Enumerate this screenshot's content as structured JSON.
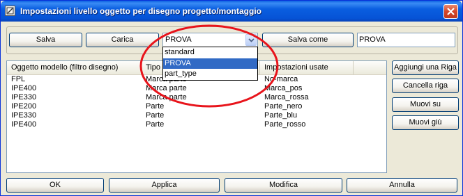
{
  "window": {
    "title": "Impostazioni livello oggetto per disegno progetto/montaggio"
  },
  "toolbar": {
    "save_label": "Salva",
    "load_label": "Carica",
    "save_as_label": "Salva come",
    "preset_combo_value": "PROVA",
    "preset_name_value": "PROVA",
    "preset_options": [
      "standard",
      "PROVA",
      "part_type"
    ]
  },
  "table": {
    "columns": [
      "Oggetto modello (filtro disegno)",
      "Tipo d",
      "Impostazioni usate"
    ],
    "rows": [
      [
        "FPL",
        "Marca parte",
        "No-marca"
      ],
      [
        "IPE400",
        "Marca parte",
        "Marca_pos"
      ],
      [
        "IPE330",
        "Marca parte",
        "Marca_rossa"
      ],
      [
        "IPE200",
        "Parte",
        "Parte_nero"
      ],
      [
        "IPE330",
        "Parte",
        "Parte_blu"
      ],
      [
        "IPE400",
        "Parte",
        "Parte_rosso"
      ]
    ]
  },
  "side_buttons": {
    "add_row": "Aggiungi una Riga",
    "delete_row": "Cancella riga",
    "move_up": "Muovi su",
    "move_down": "Muovi giù"
  },
  "bottom_buttons": {
    "ok": "OK",
    "apply": "Applica",
    "modify": "Modifica",
    "cancel": "Annulla"
  },
  "colors": {
    "annotation_ellipse": "#e8141b",
    "selection": "#316ac5"
  }
}
